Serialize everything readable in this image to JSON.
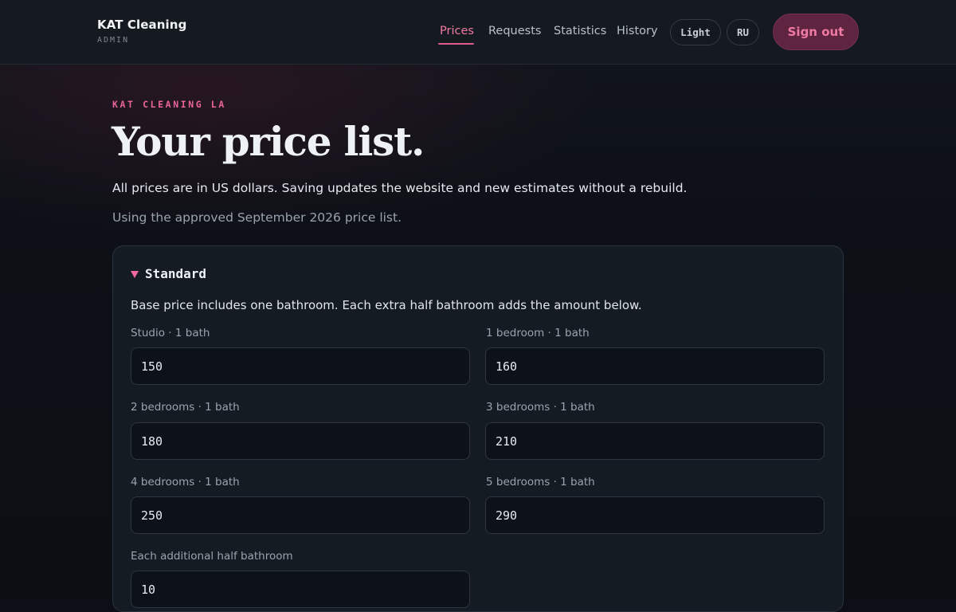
{
  "header": {
    "brand_title": "KAT Cleaning",
    "brand_subtitle": "ADMIN",
    "nav": [
      {
        "label": "Prices",
        "active": true
      },
      {
        "label": "Requests",
        "active": false
      },
      {
        "label": "Statistics",
        "active": false
      },
      {
        "label": "History",
        "active": false
      }
    ],
    "theme_toggle": "Light",
    "language_toggle": "RU",
    "sign_out": "Sign out"
  },
  "hero": {
    "eyebrow": "KAT CLEANING LA",
    "title": "Your price list.",
    "lead": "All prices are in US dollars. Saving updates the website and new estimates without a rebuild.",
    "note": "Using the approved September 2026 price list."
  },
  "section": {
    "title": "Standard",
    "expanded": true,
    "description": "Base price includes one bathroom. Each extra half bathroom adds the amount below.",
    "fields": [
      {
        "label": "Studio · 1 bath",
        "value": "150"
      },
      {
        "label": "1 bedroom · 1 bath",
        "value": "160"
      },
      {
        "label": "2 bedrooms · 1 bath",
        "value": "180"
      },
      {
        "label": "3 bedrooms · 1 bath",
        "value": "210"
      },
      {
        "label": "4 bedrooms · 1 bath",
        "value": "250"
      },
      {
        "label": "5 bedrooms · 1 bath",
        "value": "290"
      },
      {
        "label": "Each additional half bathroom",
        "value": "10"
      }
    ]
  },
  "colors": {
    "accent": "#e9649a",
    "sign_out_bg": "#5e2440",
    "background": "#0c1016",
    "card": "#151b23"
  }
}
